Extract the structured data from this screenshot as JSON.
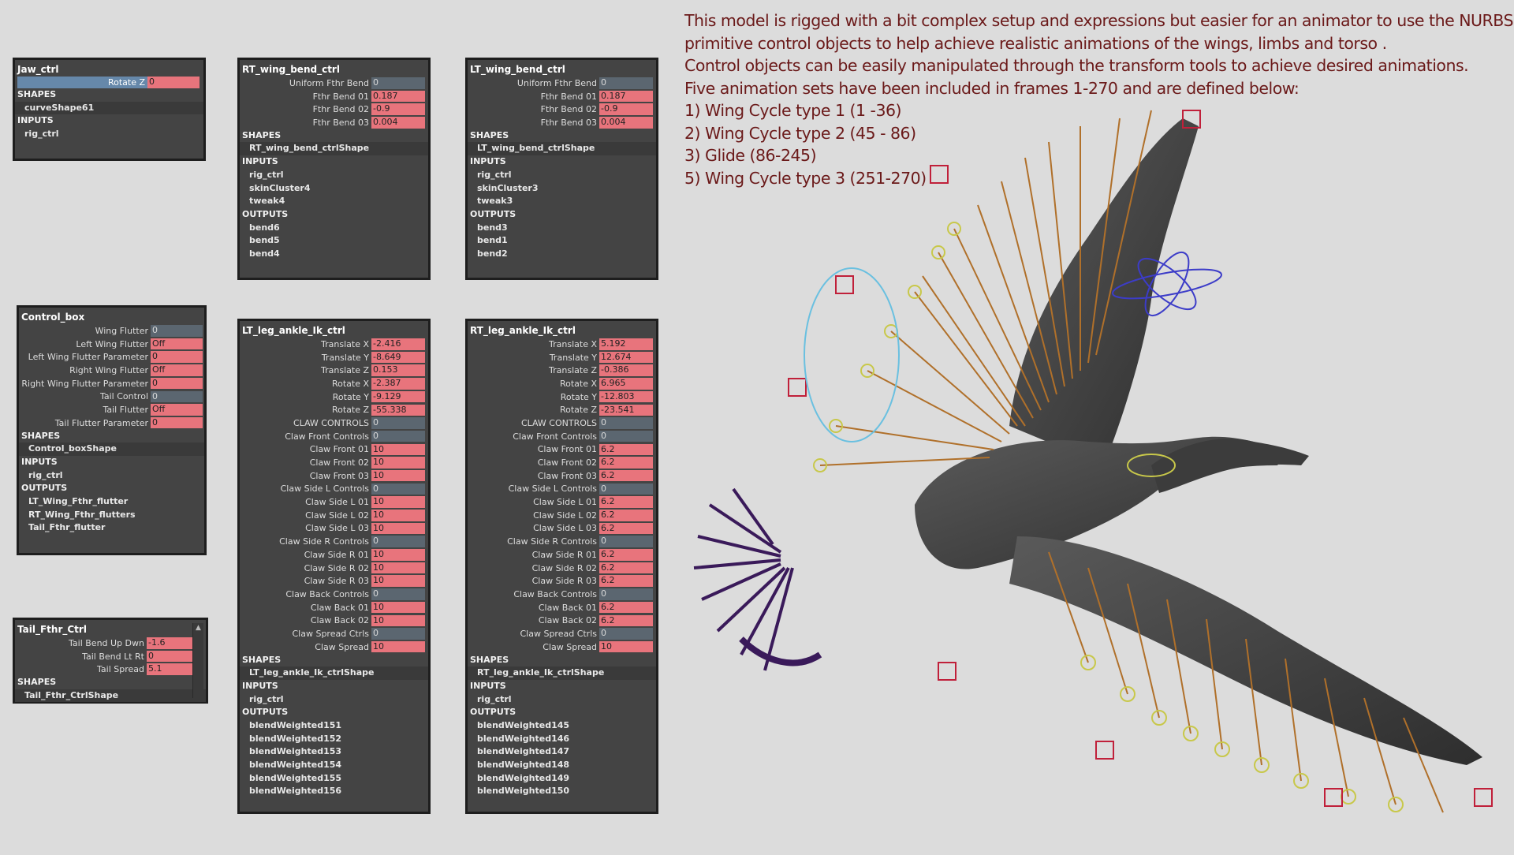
{
  "description_lines": [
    "This model is rigged with a bit complex setup and expressions but easier for an animator to use the NURBS",
    "primitive control objects to help achieve realistic animations of the wings, limbs and torso .",
    "Control objects can be easily manipulated through the transform tools to achieve desired animations.",
    "Five animation sets have been included in frames 1-270 and are defined below:",
    "1) Wing Cycle type 1 (1 -36)",
    "2) Wing Cycle type 2 (45 - 86)",
    "3) Glide (86-245)",
    "5) Wing Cycle type 3 (251-270)"
  ],
  "colors": {
    "keyed": "#e8747c",
    "plain_field": "#5b6670",
    "panel_bg": "#444444",
    "text_maroon": "#6b1a1a"
  },
  "panels": {
    "jaw": {
      "title": "Jaw_ctrl",
      "attrs": [
        {
          "label": "Rotate Z",
          "value": "0",
          "state": "keyed"
        }
      ],
      "shapes_label": "SHAPES",
      "shapes": [
        "curveShape61"
      ],
      "inputs_label": "INPUTS",
      "inputs": [
        "rig_ctrl"
      ]
    },
    "rt_wing": {
      "title": "RT_wing_bend_ctrl",
      "attrs": [
        {
          "label": "Uniform Fthr Bend",
          "value": "0",
          "state": "plain"
        },
        {
          "label": "Fthr Bend 01",
          "value": "0.187",
          "state": "keyed"
        },
        {
          "label": "Fthr Bend 02",
          "value": "-0.9",
          "state": "keyed"
        },
        {
          "label": "Fthr Bend 03",
          "value": "0.004",
          "state": "keyed"
        }
      ],
      "shapes_label": "SHAPES",
      "shapes": [
        "RT_wing_bend_ctrlShape"
      ],
      "inputs_label": "INPUTS",
      "inputs": [
        "rig_ctrl",
        "skinCluster4",
        "tweak4"
      ],
      "outputs_label": "OUTPUTS",
      "outputs": [
        "bend6",
        "bend5",
        "bend4"
      ]
    },
    "lt_wing": {
      "title": "LT_wing_bend_ctrl",
      "attrs": [
        {
          "label": "Uniform Fthr Bend",
          "value": "0",
          "state": "plain"
        },
        {
          "label": "Fthr Bend 01",
          "value": "0.187",
          "state": "keyed"
        },
        {
          "label": "Fthr Bend 02",
          "value": "-0.9",
          "state": "keyed"
        },
        {
          "label": "Fthr Bend 03",
          "value": "0.004",
          "state": "keyed"
        }
      ],
      "shapes_label": "SHAPES",
      "shapes": [
        "LT_wing_bend_ctrlShape"
      ],
      "inputs_label": "INPUTS",
      "inputs": [
        "rig_ctrl",
        "skinCluster3",
        "tweak3"
      ],
      "outputs_label": "OUTPUTS",
      "outputs": [
        "bend3",
        "bend1",
        "bend2"
      ]
    },
    "control_box": {
      "title": "Control_box",
      "attrs": [
        {
          "label": "Wing Flutter",
          "value": "0",
          "state": "plain"
        },
        {
          "label": "Left Wing Flutter",
          "value": "Off",
          "state": "keyed"
        },
        {
          "label": "Left Wing Flutter Parameter",
          "value": "0",
          "state": "keyed"
        },
        {
          "label": "Right Wing Flutter",
          "value": "Off",
          "state": "keyed"
        },
        {
          "label": "Right Wing Flutter Parameter",
          "value": "0",
          "state": "keyed"
        },
        {
          "label": "Tail Control",
          "value": "0",
          "state": "plain"
        },
        {
          "label": "Tail Flutter",
          "value": "Off",
          "state": "keyed"
        },
        {
          "label": "Tail Flutter Parameter",
          "value": "0",
          "state": "keyed"
        }
      ],
      "shapes_label": "SHAPES",
      "shapes": [
        "Control_boxShape"
      ],
      "inputs_label": "INPUTS",
      "inputs": [
        "rig_ctrl"
      ],
      "outputs_label": "OUTPUTS",
      "outputs": [
        "LT_Wing_Fthr_flutter",
        "RT_Wing_Fthr_flutters",
        "Tail_Fthr_flutter"
      ]
    },
    "lt_leg": {
      "title": "LT_leg_ankle_Ik_ctrl",
      "attrs": [
        {
          "label": "Translate X",
          "value": "-2.416",
          "state": "keyed"
        },
        {
          "label": "Translate Y",
          "value": "-8.649",
          "state": "keyed"
        },
        {
          "label": "Translate Z",
          "value": "0.153",
          "state": "keyed"
        },
        {
          "label": "Rotate X",
          "value": "-2.387",
          "state": "keyed"
        },
        {
          "label": "Rotate Y",
          "value": "-9.129",
          "state": "keyed"
        },
        {
          "label": "Rotate Z",
          "value": "-55.338",
          "state": "keyed"
        },
        {
          "label": "CLAW CONTROLS",
          "value": "0",
          "state": "plain"
        },
        {
          "label": "Claw Front Controls",
          "value": "0",
          "state": "plain"
        },
        {
          "label": "Claw Front 01",
          "value": "10",
          "state": "keyed"
        },
        {
          "label": "Claw Front 02",
          "value": "10",
          "state": "keyed"
        },
        {
          "label": "Claw Front 03",
          "value": "10",
          "state": "keyed"
        },
        {
          "label": "Claw Side L Controls",
          "value": "0",
          "state": "plain"
        },
        {
          "label": "Claw Side L 01",
          "value": "10",
          "state": "keyed"
        },
        {
          "label": "Claw Side L 02",
          "value": "10",
          "state": "keyed"
        },
        {
          "label": "Claw Side L 03",
          "value": "10",
          "state": "keyed"
        },
        {
          "label": "Claw Side R Controls",
          "value": "0",
          "state": "plain"
        },
        {
          "label": "Claw Side R 01",
          "value": "10",
          "state": "keyed"
        },
        {
          "label": "Claw Side R 02",
          "value": "10",
          "state": "keyed"
        },
        {
          "label": "Claw Side R 03",
          "value": "10",
          "state": "keyed"
        },
        {
          "label": "Claw Back Controls",
          "value": "0",
          "state": "plain"
        },
        {
          "label": "Claw Back 01",
          "value": "10",
          "state": "keyed"
        },
        {
          "label": "Claw Back 02",
          "value": "10",
          "state": "keyed"
        },
        {
          "label": "Claw Spread Ctrls",
          "value": "0",
          "state": "plain"
        },
        {
          "label": "Claw Spread",
          "value": "10",
          "state": "keyed"
        }
      ],
      "shapes_label": "SHAPES",
      "shapes": [
        "LT_leg_ankle_Ik_ctrlShape"
      ],
      "inputs_label": "INPUTS",
      "inputs": [
        "rig_ctrl"
      ],
      "outputs_label": "OUTPUTS",
      "outputs": [
        "blendWeighted151",
        "blendWeighted152",
        "blendWeighted153",
        "blendWeighted154",
        "blendWeighted155",
        "blendWeighted156"
      ]
    },
    "rt_leg": {
      "title": "RT_leg_ankle_Ik_ctrl",
      "attrs": [
        {
          "label": "Translate X",
          "value": "5.192",
          "state": "keyed"
        },
        {
          "label": "Translate Y",
          "value": "12.674",
          "state": "keyed"
        },
        {
          "label": "Translate Z",
          "value": "-0.386",
          "state": "keyed"
        },
        {
          "label": "Rotate X",
          "value": "6.965",
          "state": "keyed"
        },
        {
          "label": "Rotate Y",
          "value": "-12.803",
          "state": "keyed"
        },
        {
          "label": "Rotate Z",
          "value": "-23.541",
          "state": "keyed"
        },
        {
          "label": "CLAW CONTROLS",
          "value": "0",
          "state": "plain"
        },
        {
          "label": "Claw Front Controls",
          "value": "0",
          "state": "plain"
        },
        {
          "label": "Claw Front 01",
          "value": "6.2",
          "state": "keyed"
        },
        {
          "label": "Claw Front 02",
          "value": "6.2",
          "state": "keyed"
        },
        {
          "label": "Claw Front 03",
          "value": "6.2",
          "state": "keyed"
        },
        {
          "label": "Claw Side L Controls",
          "value": "0",
          "state": "plain"
        },
        {
          "label": "Claw Side L 01",
          "value": "6.2",
          "state": "keyed"
        },
        {
          "label": "Claw Side L 02",
          "value": "6.2",
          "state": "keyed"
        },
        {
          "label": "Claw Side L 03",
          "value": "6.2",
          "state": "keyed"
        },
        {
          "label": "Claw Side R Controls",
          "value": "0",
          "state": "plain"
        },
        {
          "label": "Claw Side R 01",
          "value": "6.2",
          "state": "keyed"
        },
        {
          "label": "Claw Side R 02",
          "value": "6.2",
          "state": "keyed"
        },
        {
          "label": "Claw Side R 03",
          "value": "6.2",
          "state": "keyed"
        },
        {
          "label": "Claw Back Controls",
          "value": "0",
          "state": "plain"
        },
        {
          "label": "Claw Back 01",
          "value": "6.2",
          "state": "keyed"
        },
        {
          "label": "Claw Back 02",
          "value": "6.2",
          "state": "keyed"
        },
        {
          "label": "Claw Spread Ctrls",
          "value": "0",
          "state": "plain"
        },
        {
          "label": "Claw Spread",
          "value": "10",
          "state": "keyed"
        }
      ],
      "shapes_label": "SHAPES",
      "shapes": [
        "RT_leg_ankle_Ik_ctrlShape"
      ],
      "inputs_label": "INPUTS",
      "inputs": [
        "rig_ctrl"
      ],
      "outputs_label": "OUTPUTS",
      "outputs": [
        "blendWeighted145",
        "blendWeighted146",
        "blendWeighted147",
        "blendWeighted148",
        "blendWeighted149",
        "blendWeighted150"
      ]
    },
    "tail": {
      "title": "Tail_Fthr_Ctrl",
      "attrs": [
        {
          "label": "Tail Bend Up Dwn",
          "value": "-1.6",
          "state": "keyed"
        },
        {
          "label": "Tail Bend Lt Rt",
          "value": "0",
          "state": "keyed"
        },
        {
          "label": "Tail Spread",
          "value": "5.1",
          "state": "keyed"
        }
      ],
      "shapes_label": "SHAPES",
      "shapes": [
        "Tail_Fthr_CtrlShape"
      ],
      "scroll_up_glyph": "▲"
    }
  }
}
